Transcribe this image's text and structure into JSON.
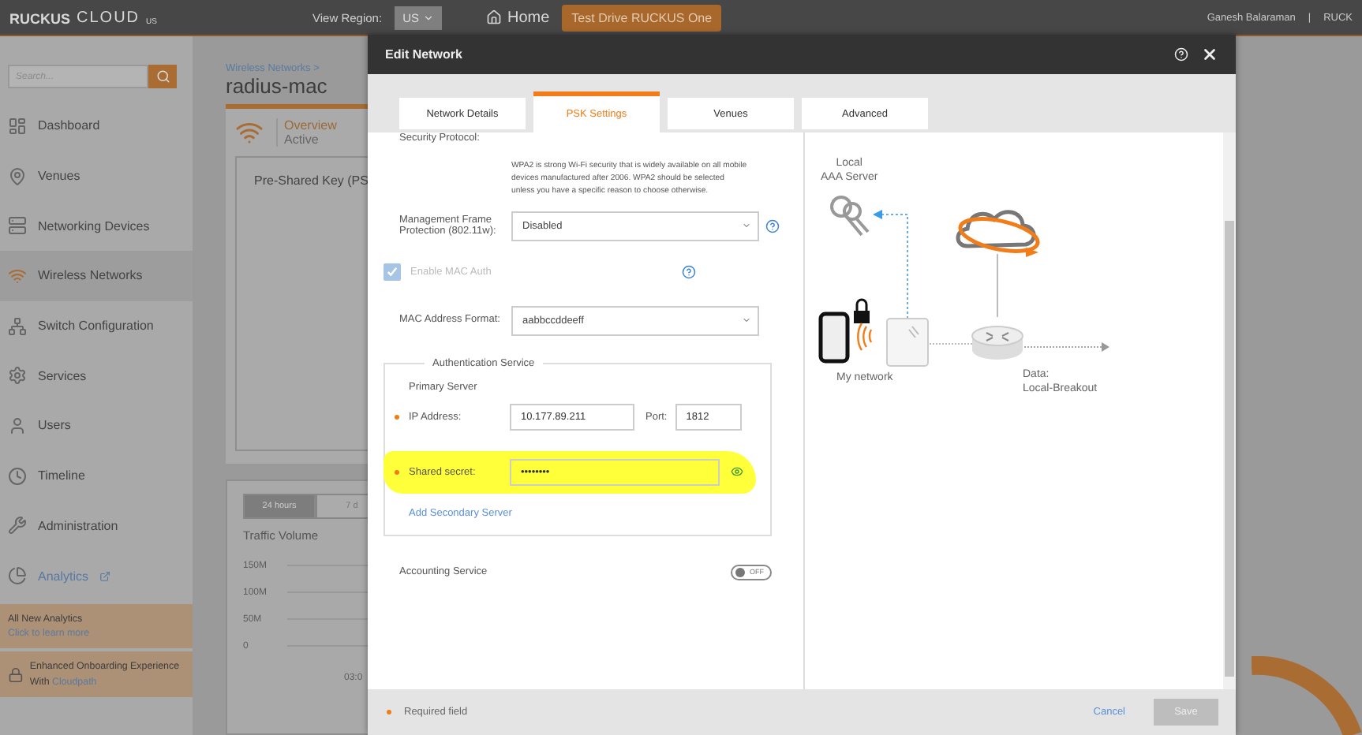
{
  "top_bar": {
    "logo": {
      "brand": "RUCKUS",
      "product": "CLOUD",
      "region": "US"
    },
    "region_label": "View Region:",
    "region_value": "US",
    "home": "Home",
    "promo_button": "Test Drive RUCKUS One",
    "user": "Ganesh Balaraman",
    "separator": "|",
    "account": "RUCK"
  },
  "sidebar": {
    "search": {
      "placeholder": "Search..."
    },
    "items": [
      {
        "label": "Dashboard",
        "selected": false,
        "kind": "item"
      },
      {
        "label": "Venues",
        "selected": false,
        "kind": "item"
      },
      {
        "label": "Networking Devices",
        "selected": false,
        "kind": "item"
      },
      {
        "label": "Wireless Networks",
        "selected": true,
        "kind": "item"
      },
      {
        "label": "Switch Configuration",
        "selected": false,
        "kind": "item"
      },
      {
        "label": "Services",
        "selected": false,
        "kind": "item"
      },
      {
        "label": "Users",
        "selected": false,
        "kind": "item"
      },
      {
        "label": "Timeline",
        "selected": false,
        "kind": "item"
      },
      {
        "label": "Administration",
        "selected": false,
        "kind": "item"
      },
      {
        "label": "Analytics",
        "selected": false,
        "kind": "external"
      }
    ],
    "promos": [
      {
        "text": "All New Analytics",
        "link": "Click to learn more"
      },
      {
        "text": "Enhanced Onboarding Experience With",
        "link": "Cloudpath"
      }
    ]
  },
  "main": {
    "breadcrumb": "Wireless Networks >",
    "title": "radius-mac",
    "overview": {
      "label": "Overview",
      "status": "Active"
    },
    "card_title": "Pre-Shared Key (PS",
    "range_tabs": [
      {
        "label": "24 hours",
        "selected": true
      },
      {
        "label": "7 d",
        "selected": false
      }
    ],
    "chart_title": "Traffic Volume",
    "y_labels": [
      "150M",
      "100M",
      "50M",
      "0"
    ],
    "x_label": "03:0"
  },
  "dialog": {
    "title": "Edit Network",
    "tabs": [
      {
        "label": "Network Details",
        "selected": false
      },
      {
        "label": "PSK Settings",
        "selected": true
      },
      {
        "label": "Venues",
        "selected": false
      },
      {
        "label": "Advanced",
        "selected": false
      }
    ],
    "form": {
      "security_protocol_label": "Security Protocol:",
      "security_note": "WPA2 is strong Wi-Fi security that is widely available on all mobile devices manufactured after 2006. WPA2 should be selected unless you have a specific reason to choose otherwise.",
      "mfp": {
        "label": "Management Frame Protection (802.11w):",
        "value": "Disabled"
      },
      "mac_auth": {
        "label": "Enable MAC Auth",
        "checked": true,
        "disabled": true
      },
      "mac_format": {
        "label": "MAC Address Format:",
        "value": "aabbccddeeff"
      },
      "auth_service": {
        "legend": "Authentication Service",
        "primary_heading": "Primary Server",
        "ip": {
          "label": "IP Address:",
          "value": "10.177.89.211",
          "required": true
        },
        "port": {
          "label": "Port:",
          "value": "1812"
        },
        "secret": {
          "label": "Shared secret:",
          "value": "••••••••",
          "required": true,
          "highlighted": true
        },
        "add_link": "Add Secondary Server"
      },
      "accounting": {
        "label": "Accounting Service",
        "on": false,
        "state_text": "OFF"
      }
    },
    "diagram": {
      "aaa_label": "Local\nAAA Server",
      "network_label": "My network",
      "data_label": "Data:\nLocal-Breakout"
    },
    "footer": {
      "required_note": "Required field",
      "cancel": "Cancel",
      "save": "Save",
      "save_disabled": true
    }
  }
}
